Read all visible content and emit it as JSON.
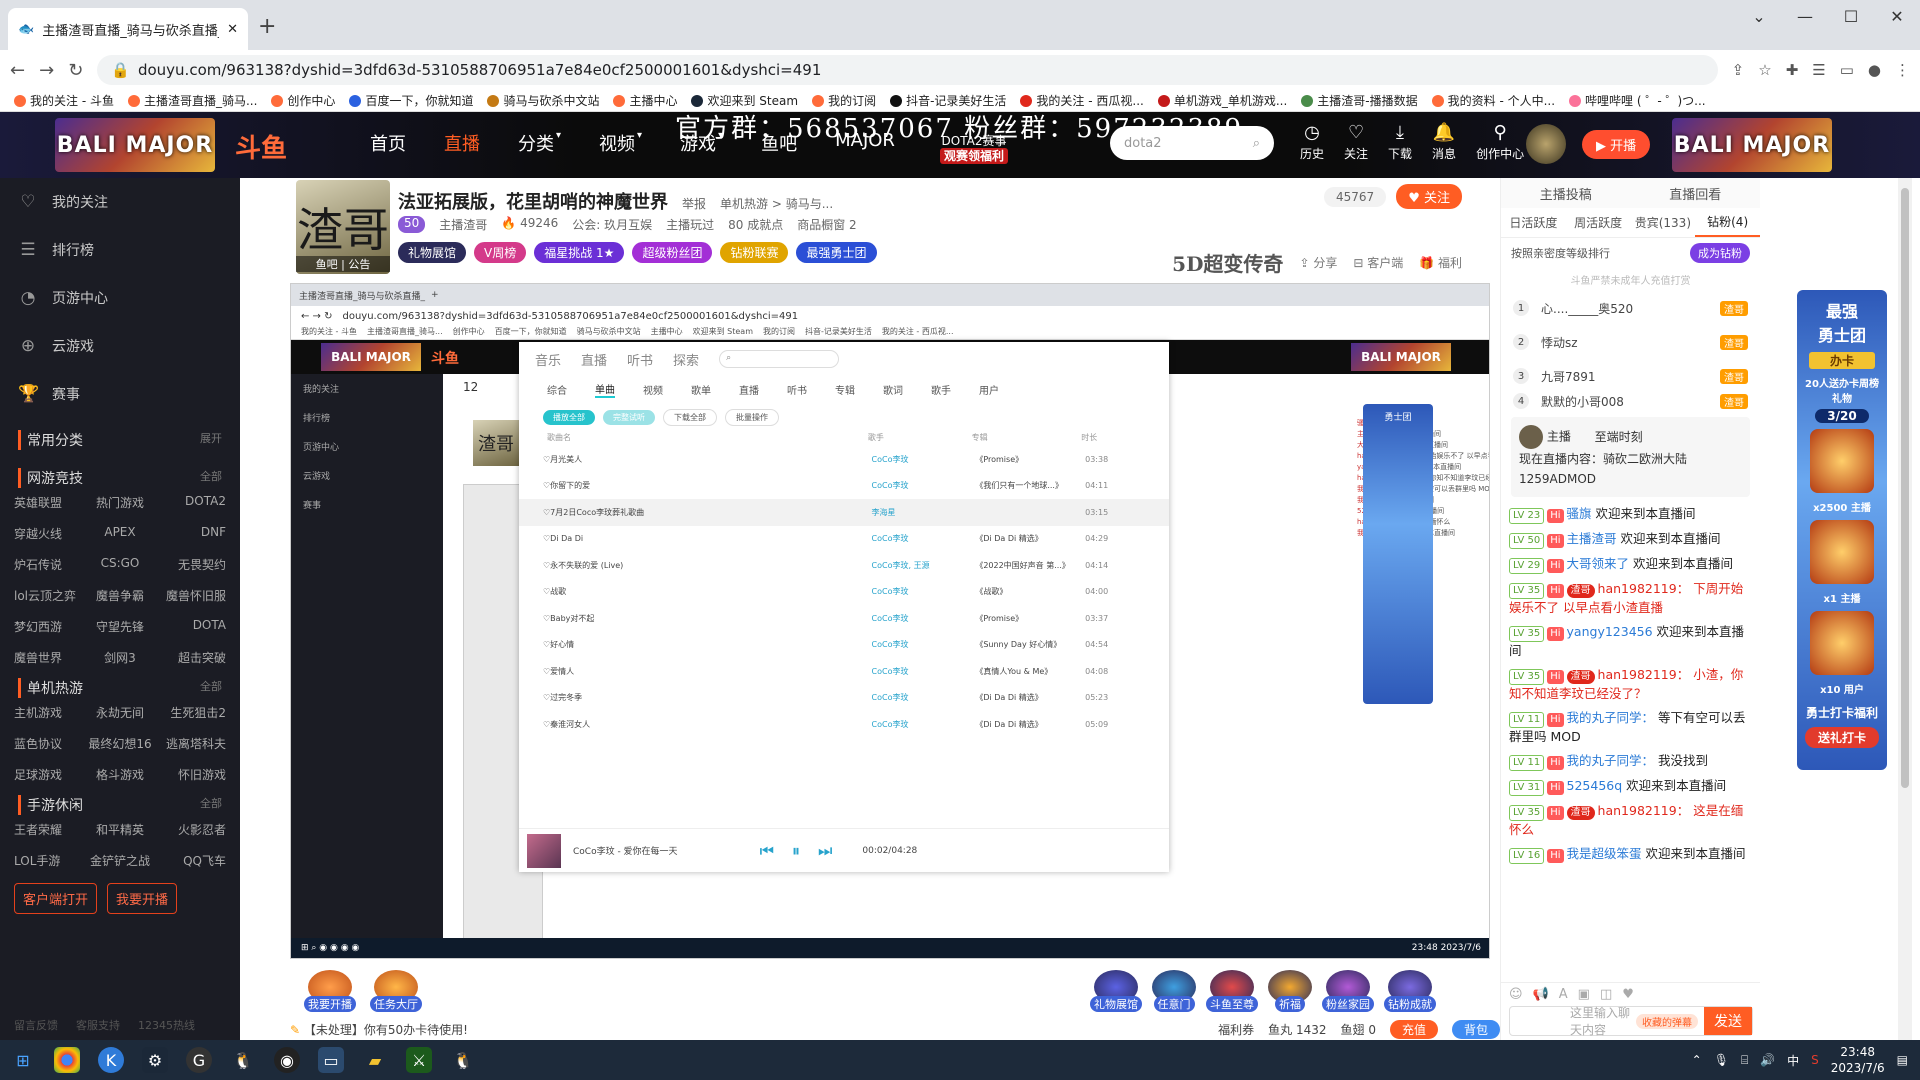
{
  "browser": {
    "tab_title": "主播渣哥直播_骑马与砍杀直播_",
    "url": "douyu.com/963138?dyshid=3dfd63d-5310588706951a7e84e0cf2500001601&dyshci=491",
    "bookmarks": [
      "我的关注 - 斗鱼",
      "主播渣哥直播_骑马...",
      "创作中心",
      "百度一下，你就知道",
      "骑马与砍杀中文站",
      "主播中心",
      "欢迎来到 Steam",
      "我的订阅",
      "抖音-记录美好生活",
      "我的关注 - 西瓜视...",
      "单机游戏_单机游戏...",
      "主播渣哥-播播数据",
      "我的资料 - 个人中...",
      "哔哩哔哩 ( ゜- ゜)つ..."
    ]
  },
  "header": {
    "banner": "BALI MAJOR",
    "logo": "斗鱼",
    "nav": [
      "首页",
      "直播",
      "分类",
      "视频",
      "游戏",
      "鱼吧",
      "MAJOR"
    ],
    "slogan": "官方群：568537067  粉丝群：597232389",
    "dota_line1": "DOTA2赛事",
    "dota_line2": "观赛领福利",
    "search_placeholder": "dota2",
    "icons": [
      "历史",
      "关注",
      "下载",
      "消息",
      "创作中心"
    ],
    "kaibo": "开播"
  },
  "sidebar": {
    "items": [
      "我的关注",
      "排行榜",
      "页游中心",
      "云游戏",
      "赛事"
    ],
    "common": "常用分类",
    "expand": "展开",
    "sections": [
      {
        "title": "网游竞技",
        "more": "全部",
        "games": [
          "英雄联盟",
          "热门游戏",
          "DOTA2",
          "穿越火线",
          "APEX",
          "DNF",
          "炉石传说",
          "CS:GO",
          "无畏契约",
          "lol云顶之弈",
          "魔兽争霸",
          "魔兽怀旧服",
          "梦幻西游",
          "守望先锋",
          "DOTA",
          "魔兽世界",
          "剑网3",
          "超击突破"
        ]
      },
      {
        "title": "单机热游",
        "more": "全部",
        "games": [
          "主机游戏",
          "永劫无间",
          "生死狙击2",
          "蓝色协议",
          "最终幻想16",
          "逃离塔科夫",
          "足球游戏",
          "格斗游戏",
          "怀旧游戏"
        ]
      },
      {
        "title": "手游休闲",
        "more": "全部",
        "games": [
          "王者荣耀",
          "和平精英",
          "火影忍者",
          "LOL手游",
          "金铲铲之战",
          "QQ飞车"
        ]
      }
    ],
    "btn_client": "客户端打开",
    "btn_kaibo": "我要开播",
    "footer": [
      "留言反馈",
      "客服支持",
      "12345热线"
    ]
  },
  "room": {
    "avatar_char": "渣哥",
    "avatar_sub": "鱼吧 | 公告",
    "title": "法亚拓展版，花里胡哨的神魔世界",
    "report": "举报",
    "category": "单机热游 > 骑马与...",
    "level": "50",
    "host": "主播渣哥",
    "hot": "49246",
    "guild": "公会: 玖月互娱",
    "play": "主播玩过",
    "achieve": "80 成就点",
    "shop": "商品橱窗 2",
    "tags": [
      "礼物展馆",
      "V周榜",
      "福星挑战 1★",
      "超级粉丝团",
      "钻粉联赛",
      "最强勇士团"
    ],
    "follow_count": "45767",
    "follow_btn": "关注",
    "brand": "5D超变传奇",
    "share": "分享",
    "client": "客户端",
    "welfare": "福利"
  },
  "music": {
    "top": [
      "音乐",
      "直播",
      "听书",
      "探索"
    ],
    "tabs": [
      "综合",
      "单曲",
      "视频",
      "歌单",
      "直播",
      "听书",
      "专辑",
      "歌词",
      "歌手",
      "用户"
    ],
    "btns": [
      "播放全部",
      "完整试听",
      "下载全部",
      "批量操作"
    ],
    "cols": [
      "歌曲名",
      "歌手",
      "专辑",
      "时长"
    ],
    "rows": [
      [
        "月光美人",
        "CoCo李玟",
        "《Promise》",
        "03:38"
      ],
      [
        "你留下的爱",
        "CoCo李玟",
        "《我们只有一个地球...》",
        "04:11"
      ],
      [
        "7月2日Coco李玟葬礼歌曲",
        "李海星",
        "",
        "03:15"
      ],
      [
        "Di Da Di",
        "CoCo李玟",
        "《Di Da Di 精选》",
        "04:29"
      ],
      [
        "永不失联的爱 (Live)",
        "CoCo李玟, 王源",
        "《2022中国好声音 第...》",
        "04:14"
      ],
      [
        "战歌",
        "CoCo李玟",
        "《战歌》",
        "04:00"
      ],
      [
        "Baby对不起",
        "CoCo李玟",
        "《Promise》",
        "03:37"
      ],
      [
        "好心情",
        "CoCo李玟",
        "《Sunny Day 好心情》",
        "04:54"
      ],
      [
        "爱情人",
        "CoCo李玟",
        "《真情人You & Me》",
        "04:08"
      ],
      [
        "过完冬季",
        "CoCo李玟",
        "《Di Da Di 精选》",
        "05:23"
      ],
      [
        "秦淮河女人",
        "CoCo李玟",
        "《Di Da Di 精选》",
        "05:09"
      ]
    ],
    "now_playing": "CoCo李玟 - 爱你在每一天",
    "time": "00:02/04:28"
  },
  "gifts": [
    "我要开播",
    "任务大厅",
    "礼物展馆",
    "任意门",
    "斗鱼至尊",
    "祈福",
    "粉丝家园",
    "钻粉成就"
  ],
  "bottom": {
    "notice": "【未处理】你有50办卡待使用!",
    "welfare": "福利券",
    "fish": "鱼丸 1432",
    "fishball": "鱼翅 0",
    "charge": "充值",
    "bag": "背包"
  },
  "right": {
    "top": [
      "主播投稿",
      "直播回看"
    ],
    "tabs": [
      "日活跃度",
      "周活跃度",
      "贵宾(133)",
      "钻粉(4)"
    ],
    "sort": "按照亲密度等级排行",
    "become": "成为钻粉",
    "notice": "斗鱼严禁未成年人充值打赏",
    "ranks": [
      [
        "1",
        "心...._____奥520",
        "渣哥"
      ],
      [
        "2",
        "悸动sz",
        "渣哥"
      ],
      [
        "3",
        "九哥7891",
        "渣哥"
      ],
      [
        "4",
        "默默的小哥008",
        "渣哥"
      ]
    ],
    "host_label": "主播",
    "host_status": "至端时刻",
    "live_content": "现在直播内容：骑砍二欧洲大陆1259ADMOD",
    "chat": [
      {
        "lv": "LV 23",
        "name": "骚旗",
        "text": "欢迎来到本直播间"
      },
      {
        "lv": "LV 50",
        "name": "主播渣哥",
        "text": "欢迎来到本直播间"
      },
      {
        "lv": "LV 29",
        "name": "大哥领来了",
        "text": "欢迎来到本直播间"
      },
      {
        "lv": "LV 35",
        "fan": "渣哥",
        "name": "han1982119：",
        "text": "下周开始娱乐不了  以早点看小渣直播"
      },
      {
        "lv": "LV 35",
        "name": "yangy123456",
        "text": "欢迎来到本直播间"
      },
      {
        "lv": "LV 35",
        "fan": "渣哥",
        "name": "han1982119：",
        "text": "小渣，你知不知道李玟已经没了？"
      },
      {
        "lv": "LV 11",
        "name": "我的丸子同学：",
        "text": "等下有空可以丢群里吗 MOD"
      },
      {
        "lv": "LV 11",
        "name": "我的丸子同学：",
        "text": "我没找到"
      },
      {
        "lv": "LV 31",
        "name": "525456q",
        "text": "欢迎来到本直播间"
      },
      {
        "lv": "LV 35",
        "fan": "渣哥",
        "name": "han1982119：",
        "text": "这是在缅怀么"
      },
      {
        "lv": "LV 16",
        "name": "我是超级笨蛋",
        "text": "欢迎来到本直播间"
      }
    ],
    "input_placeholder": "这里输入聊天内容",
    "bubble": "收藏的弹幕",
    "send": "发送"
  },
  "float": {
    "title1": "最强",
    "title2": "勇士团",
    "card": "办卡",
    "desc": "20人送办卡周榜礼物",
    "progress": "3/20",
    "x1": "x2500",
    "host1": "主播",
    "x2": "x1",
    "host2": "主播",
    "x3": "x10",
    "user": "用户",
    "welfare": "勇士打卡福利",
    "send": "送礼打卡"
  },
  "taskbar": {
    "time": "23:48",
    "date": "2023/7/6",
    "lang": "中"
  }
}
